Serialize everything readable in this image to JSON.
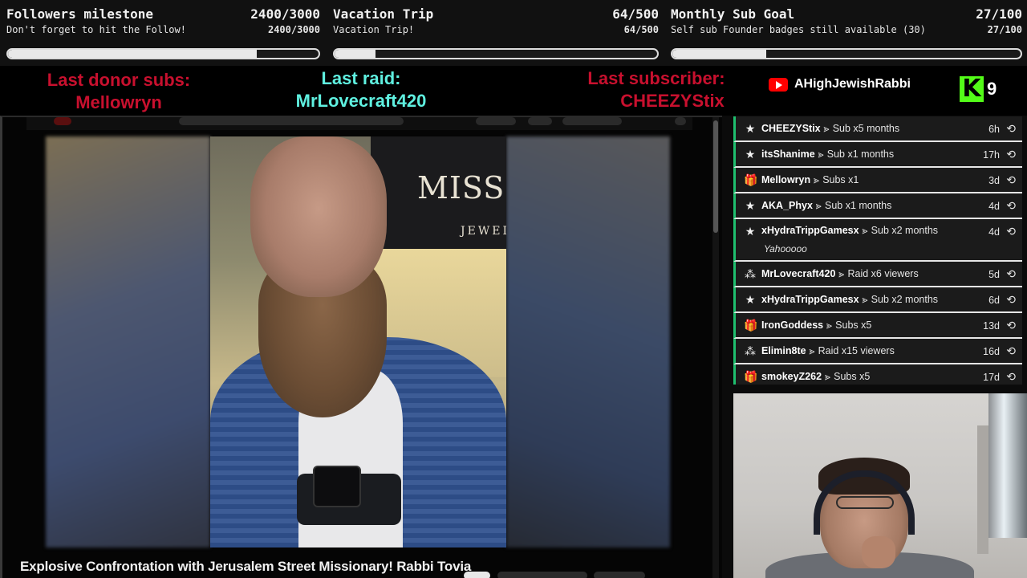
{
  "goals": [
    {
      "title": "Followers milestone",
      "subtitle": "Don't forget to hit the Follow!",
      "count": "2400/3000",
      "count2": "2400/3000",
      "progress": 0.8
    },
    {
      "title": "Vacation Trip",
      "subtitle": "Vacation Trip!",
      "count": "64/500",
      "count2": "64/500",
      "progress": 0.128
    },
    {
      "title": "Monthly Sub Goal",
      "subtitle": "Self sub Founder badges still available (30)",
      "count": "27/100",
      "count2": "27/100",
      "progress": 0.27
    }
  ],
  "alerts": {
    "donor_label": "Last donor subs:",
    "donor_name": "Mellowryn",
    "raid_label": "Last raid:",
    "raid_name": "MrLovecraft420",
    "sub_label": "Last subscriber:",
    "sub_name": "CHEEZYStix"
  },
  "social": {
    "youtube_name": "AHighJewishRabbi",
    "kick_logo": "K",
    "kick_count": "9"
  },
  "video": {
    "title": "Explosive Confrontation with Jerusalem Street Missionary! Rabbi Tovia",
    "sign_text": "MISS A",
    "sign_sub": "JEWELR"
  },
  "events": [
    {
      "icon": "star-icon",
      "glyph": "★",
      "name": "CHEEZYStix",
      "what": "Sub x5 months",
      "time": "6h"
    },
    {
      "icon": "star-icon",
      "glyph": "★",
      "name": "itsShanime",
      "what": "Sub x1 months",
      "time": "17h"
    },
    {
      "icon": "gift-icon",
      "glyph": "🎁",
      "name": "Mellowryn",
      "what": "Subs x1",
      "time": "3d"
    },
    {
      "icon": "star-icon",
      "glyph": "★",
      "name": "AKA_Phyx",
      "what": "Sub x1 months",
      "time": "4d"
    },
    {
      "icon": "star-icon",
      "glyph": "★",
      "name": "xHydraTrippGamesx",
      "what": "Sub x2 months",
      "time": "4d",
      "message": "Yahooooo"
    },
    {
      "icon": "raid-icon",
      "glyph": "⁂",
      "name": "MrLovecraft420",
      "what": "Raid x6 viewers",
      "time": "5d"
    },
    {
      "icon": "star-icon",
      "glyph": "★",
      "name": "xHydraTrippGamesx",
      "what": "Sub x2 months",
      "time": "6d"
    },
    {
      "icon": "gift-icon",
      "glyph": "🎁",
      "name": "IronGoddess",
      "what": "Subs x5",
      "time": "13d"
    },
    {
      "icon": "raid-icon",
      "glyph": "⁂",
      "name": "Elimin8te",
      "what": "Raid x15 viewers",
      "time": "16d"
    },
    {
      "icon": "gift-icon",
      "glyph": "🎁",
      "name": "smokeyZ262",
      "what": "Subs x5",
      "time": "17d"
    }
  ],
  "event_arrow": "⪢",
  "replay_glyph": "⟲",
  "colors": {
    "accent_red": "#c8102e",
    "accent_teal": "#5ff0e0",
    "kick_green": "#53fc18",
    "event_border": "#1fbf6f"
  }
}
